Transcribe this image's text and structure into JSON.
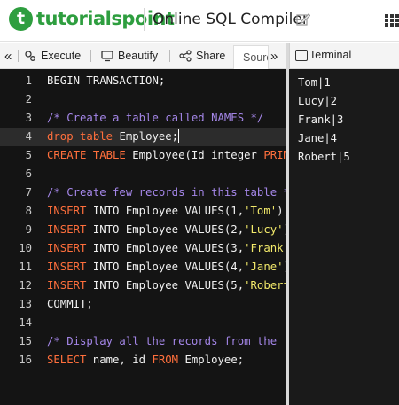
{
  "header": {
    "logo_mark": "t",
    "logo_text": "tutorialspoint",
    "title": "Online SQL Compiler",
    "edit_icon": "pencil-icon",
    "apps_icon": "grid-icon"
  },
  "toolbar": {
    "collapse_glyph": "«",
    "expand_glyph": "»",
    "execute_label": "Execute",
    "beautify_label": "Beautify",
    "share_label": "Share",
    "source_tab_label": "Source Code"
  },
  "terminal": {
    "title": "Terminal",
    "output": [
      "Tom|1",
      "Lucy|2",
      "Frank|3",
      "Jane|4",
      "Robert|5"
    ]
  },
  "editor": {
    "active_line": 4,
    "lines": [
      [
        {
          "t": "BEGIN TRANSACTION;",
          "c": ""
        }
      ],
      [],
      [
        {
          "t": "/* Create a table called NAMES */",
          "c": "cmt"
        }
      ],
      [
        {
          "t": "drop table",
          "c": "kw"
        },
        {
          "t": " Employee;",
          "c": ""
        }
      ],
      [
        {
          "t": "CREATE TABLE",
          "c": "kw"
        },
        {
          "t": " Employee(Id integer ",
          "c": ""
        },
        {
          "t": "PRIMARY KEY",
          "c": "kw"
        }
      ],
      [],
      [
        {
          "t": "/* Create few records in this table */",
          "c": "cmt"
        }
      ],
      [
        {
          "t": "INSERT",
          "c": "kw"
        },
        {
          "t": " INTO Employee VALUES(1,",
          "c": ""
        },
        {
          "t": "'Tom'",
          "c": "str"
        },
        {
          "t": ");",
          "c": ""
        }
      ],
      [
        {
          "t": "INSERT",
          "c": "kw"
        },
        {
          "t": " INTO Employee VALUES(2,",
          "c": ""
        },
        {
          "t": "'Lucy'",
          "c": "str"
        },
        {
          "t": ");",
          "c": ""
        }
      ],
      [
        {
          "t": "INSERT",
          "c": "kw"
        },
        {
          "t": " INTO Employee VALUES(3,",
          "c": ""
        },
        {
          "t": "'Frank'",
          "c": "str"
        },
        {
          "t": ");",
          "c": ""
        }
      ],
      [
        {
          "t": "INSERT",
          "c": "kw"
        },
        {
          "t": " INTO Employee VALUES(4,",
          "c": ""
        },
        {
          "t": "'Jane'",
          "c": "str"
        },
        {
          "t": ");",
          "c": ""
        }
      ],
      [
        {
          "t": "INSERT",
          "c": "kw"
        },
        {
          "t": " INTO Employee VALUES(5,",
          "c": ""
        },
        {
          "t": "'Robert'",
          "c": "str"
        },
        {
          "t": ");",
          "c": ""
        }
      ],
      [
        {
          "t": "COMMIT;",
          "c": ""
        }
      ],
      [],
      [
        {
          "t": "/* Display all the records from the table */",
          "c": "cmt"
        }
      ],
      [
        {
          "t": "SELECT",
          "c": "kw"
        },
        {
          "t": " name, id ",
          "c": ""
        },
        {
          "t": "FROM",
          "c": "kw"
        },
        {
          "t": " Employee;",
          "c": ""
        }
      ]
    ]
  },
  "colors": {
    "brand": "#2e9e3f",
    "keyword": "#ff6f3c",
    "comment": "#a486e8",
    "string": "#f2e96a",
    "editor_bg": "#141414"
  }
}
